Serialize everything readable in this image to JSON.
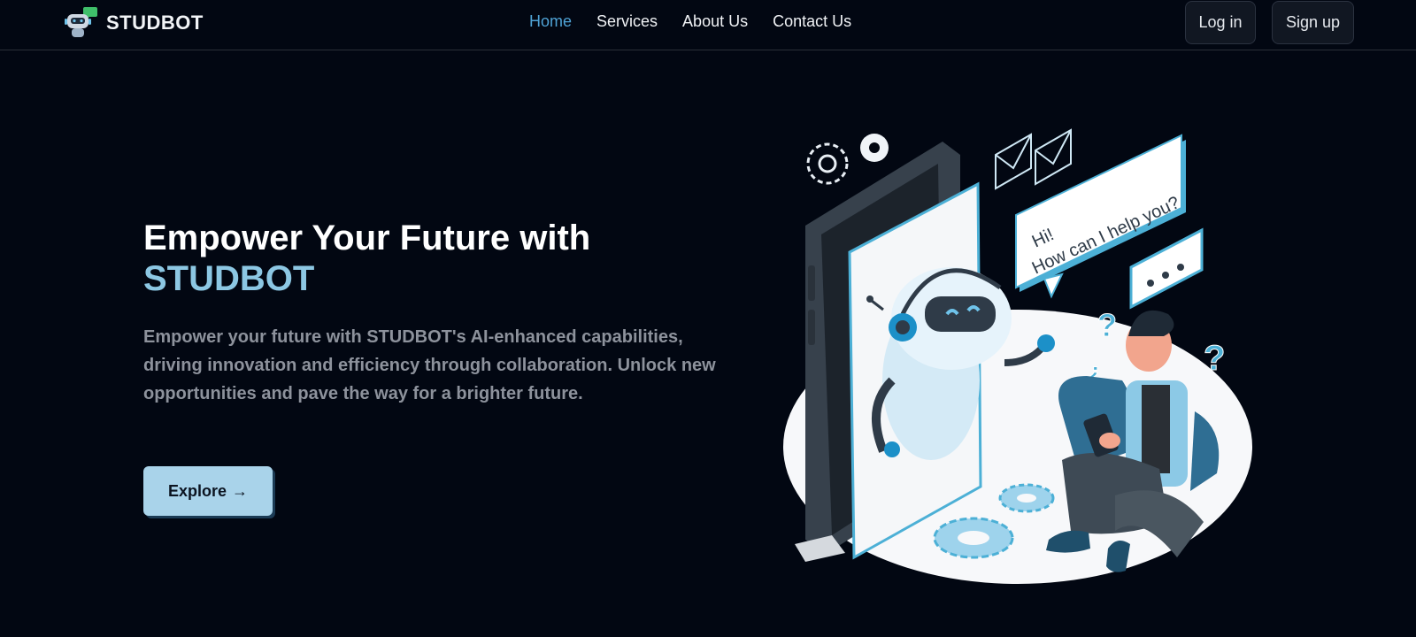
{
  "brand": {
    "name": "STUDBOT",
    "logo_icon": "robot-chat-icon"
  },
  "nav": {
    "links": [
      {
        "label": "Home",
        "active": true
      },
      {
        "label": "Services",
        "active": false
      },
      {
        "label": "About Us",
        "active": false
      },
      {
        "label": "Contact Us",
        "active": false
      }
    ],
    "login_label": "Log in",
    "signup_label": "Sign up"
  },
  "hero": {
    "title_line1": "Empower Your Future with",
    "title_accent": "STUDBOT",
    "description": "Empower your future with STUDBOT's AI-enhanced capabilities, driving innovation and efficiency through collaboration. Unlock new opportunities and pave the way for a brighter future.",
    "cta_label": "Explore",
    "cta_icon": "→"
  },
  "illustration": {
    "speech_bubble_text_1": "Hi!",
    "speech_bubble_text_2": "How can I help you?"
  },
  "colors": {
    "background": "#020712",
    "accent_blue": "#4fa3d6",
    "title_accent": "#8cc7e3",
    "cta_bg": "#a9d3ea"
  }
}
